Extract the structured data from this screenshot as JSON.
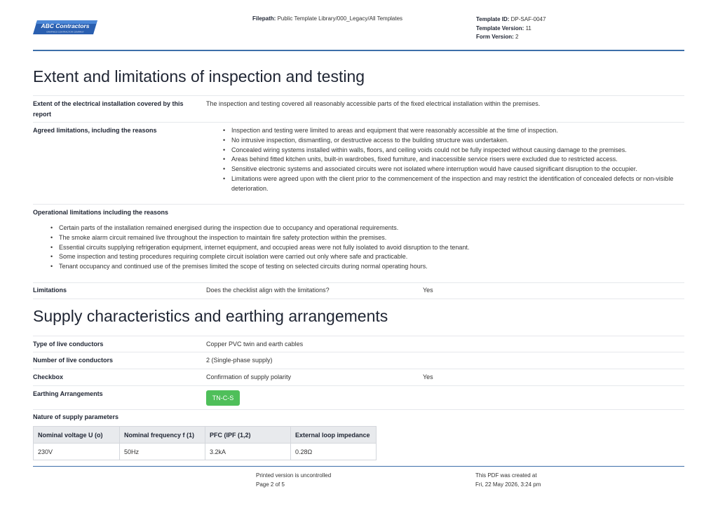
{
  "header": {
    "logo_text": "ABC Contractors",
    "logo_subtext": "GRAPHICS CONTRACTOR COMPANY",
    "filepath_label": "Filepath:",
    "filepath_value": "Public Template Library/000_Legacy/All Templates",
    "template_id_label": "Template ID:",
    "template_id_value": "DP-SAF-0047",
    "template_version_label": "Template Version:",
    "template_version_value": "11",
    "form_version_label": "Form Version:",
    "form_version_value": "2"
  },
  "section1": {
    "title": "Extent and limitations of inspection and testing",
    "extent_label": "Extent of the electrical installation covered by this report",
    "extent_value": "The inspection and testing covered all reasonably accessible parts of the fixed electrical installation within the premises.",
    "agreed_label": "Agreed limitations, including the reasons",
    "agreed_items": [
      "Inspection and testing were limited to areas and equipment that were reasonably accessible at the time of inspection.",
      "No intrusive inspection, dismantling, or destructive access to the building structure was undertaken.",
      "Concealed wiring systems installed within walls, floors, and ceiling voids could not be fully inspected without causing damage to the premises.",
      "Areas behind fitted kitchen units, built-in wardrobes, fixed furniture, and inaccessible service risers were excluded due to restricted access.",
      "Sensitive electronic systems and associated circuits were not isolated where interruption would have caused significant disruption to the occupier.",
      "Limitations were agreed upon with the client prior to the commencement of the inspection and may restrict the identification of concealed defects or non-visible deterioration."
    ],
    "operational_label": "Operational limitations including the reasons",
    "operational_items": [
      "Certain parts of the installation remained energised during the inspection due to occupancy and operational requirements.",
      "The smoke alarm circuit remained live throughout the inspection to maintain fire safety protection within the premises.",
      "Essential circuits supplying refrigeration equipment, internet equipment, and occupied areas were not fully isolated to avoid disruption to the tenant.",
      "Some inspection and testing procedures requiring complete circuit isolation were carried out only where safe and practicable.",
      "Tenant occupancy and continued use of the premises limited the scope of testing on selected circuits during normal operating hours."
    ],
    "limitations_label": "Limitations",
    "limitations_question": "Does the checklist align with the limitations?",
    "limitations_answer": "Yes"
  },
  "section2": {
    "title": "Supply characteristics and earthing arrangements",
    "live_conductors_type_label": "Type of live conductors",
    "live_conductors_type_value": "Copper PVC twin and earth cables",
    "live_conductors_number_label": "Number of live conductors",
    "live_conductors_number_value": "2 (Single-phase supply)",
    "checkbox_label": "Checkbox",
    "checkbox_question": "Confirmation of supply polarity",
    "checkbox_answer": "Yes",
    "earthing_label": "Earthing Arrangements",
    "earthing_badge": "TN-C-S",
    "earthing_badge_color": "#4fbf5a",
    "nature_label": "Nature of supply parameters",
    "table_headers": [
      "Nominal voltage U (o)",
      "Nominal frequency f (1)",
      "PFC (IPF (1,2)",
      "External loop impedance"
    ],
    "table_row": [
      "230V",
      "50Hz",
      "3.2kA",
      "0.28Ω"
    ]
  },
  "footer": {
    "uncontrolled": "Printed version is uncontrolled",
    "page": "Page 2 of 5",
    "created": "This PDF was created at",
    "created_date": "Fri, 22 May 2026, 3:24 pm"
  }
}
